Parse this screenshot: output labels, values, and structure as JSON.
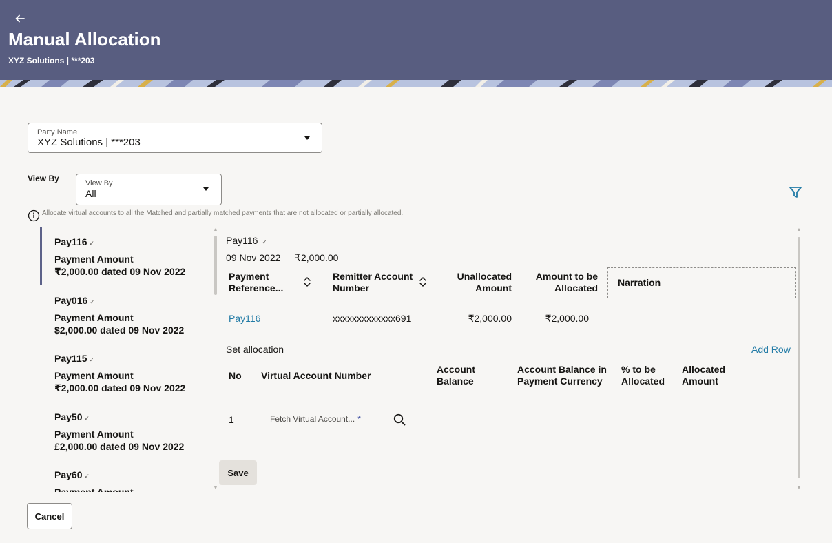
{
  "header": {
    "back_icon": "arrow-left-icon",
    "title": "Manual Allocation",
    "subtitle": "XYZ Solutions | ***203",
    "bg_color": "#585d80"
  },
  "party": {
    "label": "Party Name",
    "value": "XYZ Solutions | ***203"
  },
  "view_by": {
    "outer_label": "View By",
    "label": "View By",
    "value": "All"
  },
  "info_text": "Allocate virtual accounts to all the Matched and partially matched payments that are not allocated or partially allocated.",
  "payments": [
    {
      "ref": "Pay116",
      "check": "✓",
      "label": "Payment Amount",
      "detail": "₹2,000.00 dated 09 Nov 2022"
    },
    {
      "ref": "Pay016",
      "check": "✓",
      "label": "Payment Amount",
      "detail": "$2,000.00 dated 09 Nov 2022"
    },
    {
      "ref": "Pay115",
      "check": "✓",
      "label": "Payment Amount",
      "detail": "₹2,000.00 dated 09 Nov 2022"
    },
    {
      "ref": "Pay50",
      "check": "✓",
      "label": "Payment Amount",
      "detail": "£2,000.00 dated 09 Nov 2022"
    },
    {
      "ref": "Pay60",
      "check": "✓",
      "label": "Payment Amount",
      "detail": ""
    }
  ],
  "detail": {
    "ref": "Pay116",
    "check": "✓",
    "date": "09 Nov 2022",
    "amount": "₹2,000.00",
    "columns": {
      "payment_ref": "Payment Reference...",
      "remitter": "Remitter Account Number",
      "unallocated": "Unallocated Amount",
      "to_allocate": "Amount to be Allocated",
      "narration": "Narration"
    },
    "row": {
      "payment_ref": "Pay116",
      "remitter": "xxxxxxxxxxxxx691",
      "unallocated": "₹2,000.00",
      "to_allocate": "₹2,000.00",
      "narration": ""
    }
  },
  "allocation": {
    "title": "Set allocation",
    "add_row": "Add Row",
    "columns": {
      "no": "No",
      "va_number": "Virtual Account Number",
      "account_balance": "Account Balance",
      "balance_in_currency": "Account Balance in Payment Currency",
      "pct": "% to be Allocated",
      "allocated": "Allocated Amount"
    },
    "rows": [
      {
        "no": "1",
        "va_placeholder": "Fetch Virtual Account...",
        "required": "*"
      }
    ]
  },
  "actions": {
    "save": "Save",
    "cancel": "Cancel"
  },
  "colors": {
    "link": "#227ba6",
    "accent": "#5d6289"
  }
}
